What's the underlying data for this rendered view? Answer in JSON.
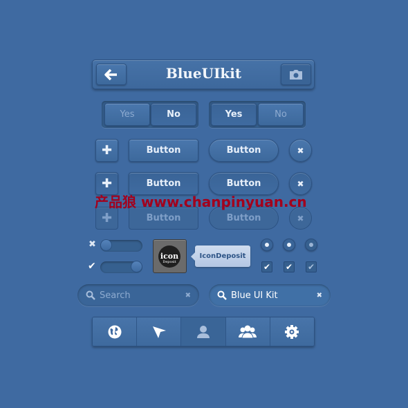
{
  "header": {
    "title": "BlueUIkit",
    "back_icon": "arrow-left-icon",
    "camera_icon": "camera-icon"
  },
  "segmented": [
    {
      "options": [
        "Yes",
        "No"
      ],
      "selected": "No"
    },
    {
      "options": [
        "Yes",
        "No"
      ],
      "selected": "Yes"
    }
  ],
  "buttons": {
    "label": "Button",
    "plus_icon": "plus-icon",
    "close_icon": "close-icon"
  },
  "watermark": {
    "text": "产品狼 www.chanpinyuan.cn",
    "color": "#a3001c"
  },
  "toggles": [
    {
      "state": "off",
      "icon": "x-icon"
    },
    {
      "state": "on",
      "icon": "check-icon"
    }
  ],
  "logo": {
    "text": "The icon Deposit"
  },
  "tooltip": {
    "text": "IconDeposit"
  },
  "radios": [
    true,
    true,
    true
  ],
  "checkboxes": [
    true,
    true,
    true
  ],
  "search": [
    {
      "placeholder": "Search",
      "value": ""
    },
    {
      "placeholder": "",
      "value": "Blue UI Kit"
    }
  ],
  "tabbar": {
    "tabs": [
      "globe-icon",
      "paper-plane-icon",
      "user-icon",
      "users-icon",
      "gear-icon"
    ],
    "active": 2
  },
  "colors": {
    "background": "#3f6aa1",
    "text": "#e8f0fa"
  }
}
